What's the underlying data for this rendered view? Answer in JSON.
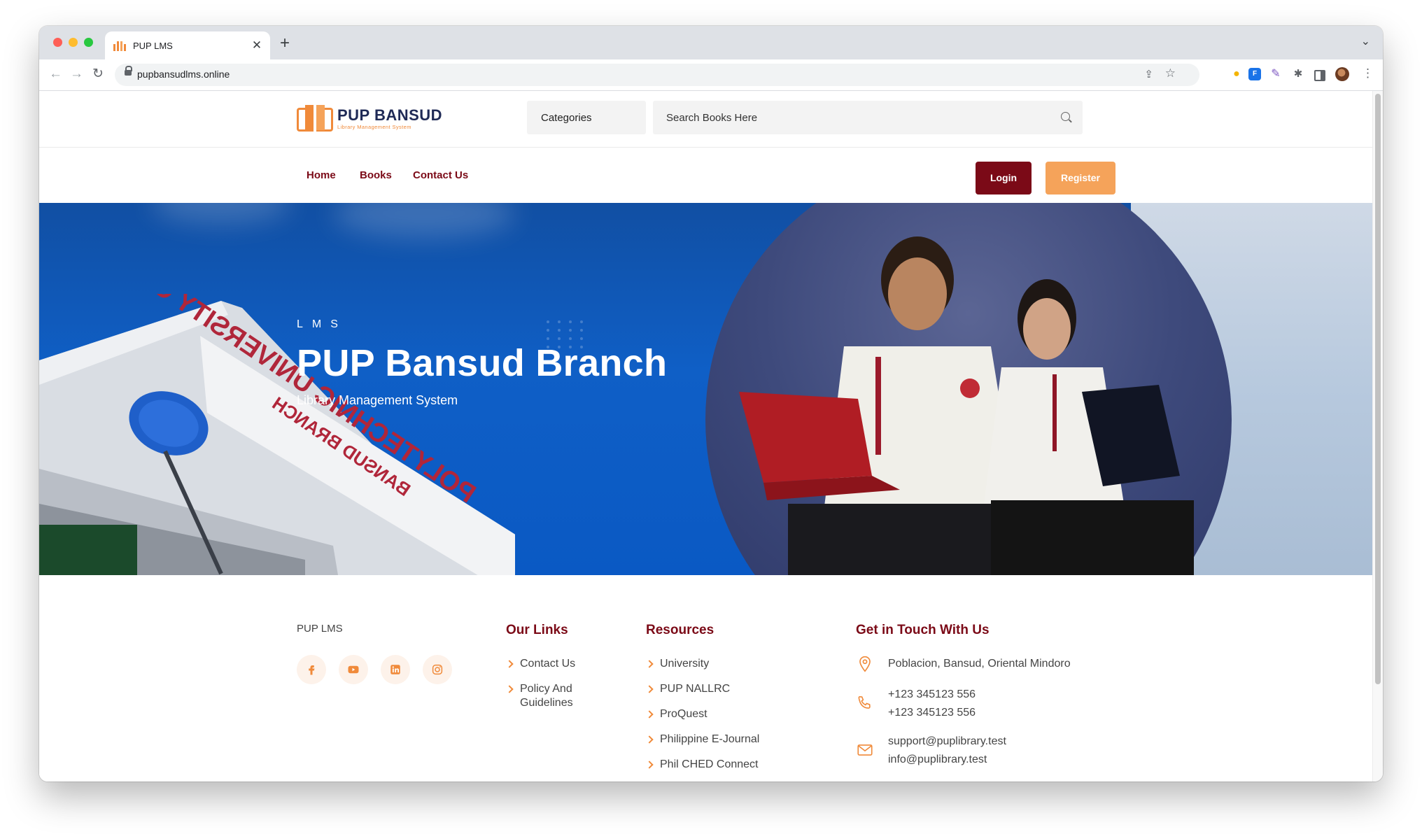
{
  "browser": {
    "tab_title": "PUP LMS",
    "url": "pupbansudlms.online"
  },
  "site": {
    "logo": {
      "name": "PUP BANSUD",
      "subtitle": "Library Management System"
    },
    "categories_label": "Categories",
    "search_placeholder": "Search Books Here",
    "nav": [
      "Home",
      "Books",
      "Contact Us"
    ],
    "login_label": "Login",
    "register_label": "Register"
  },
  "hero": {
    "eyebrow": "LMS",
    "title": "PUP Bansud Branch",
    "subtitle": "Library Management System",
    "building_text": [
      "POLYTECHNIC UNIVERSITY OF THE PHILIPPINES",
      "BANSUD BRANCH"
    ]
  },
  "footer": {
    "brand": "PUP LMS",
    "socials": [
      "facebook-icon",
      "youtube-icon",
      "linkedin-icon",
      "instagram-icon"
    ],
    "our_links": {
      "heading": "Our Links",
      "items": [
        "Contact Us",
        "Policy And Guidelines"
      ]
    },
    "resources": {
      "heading": "Resources",
      "items": [
        "University",
        "PUP NALLRC",
        "ProQuest",
        "Philippine E-Journal",
        "Phil CHED Connect"
      ]
    },
    "contact": {
      "heading": "Get in Touch With Us",
      "address": "Poblacion, Bansud, Oriental Mindoro",
      "phones": [
        "+123 345123 556",
        "+123 345123 556"
      ],
      "emails": [
        "support@puplibrary.test",
        "info@puplibrary.test"
      ]
    }
  },
  "colors": {
    "primary": "#7b0a17",
    "accent": "#f5a35a",
    "hero_blue": "#0f5fc6"
  }
}
